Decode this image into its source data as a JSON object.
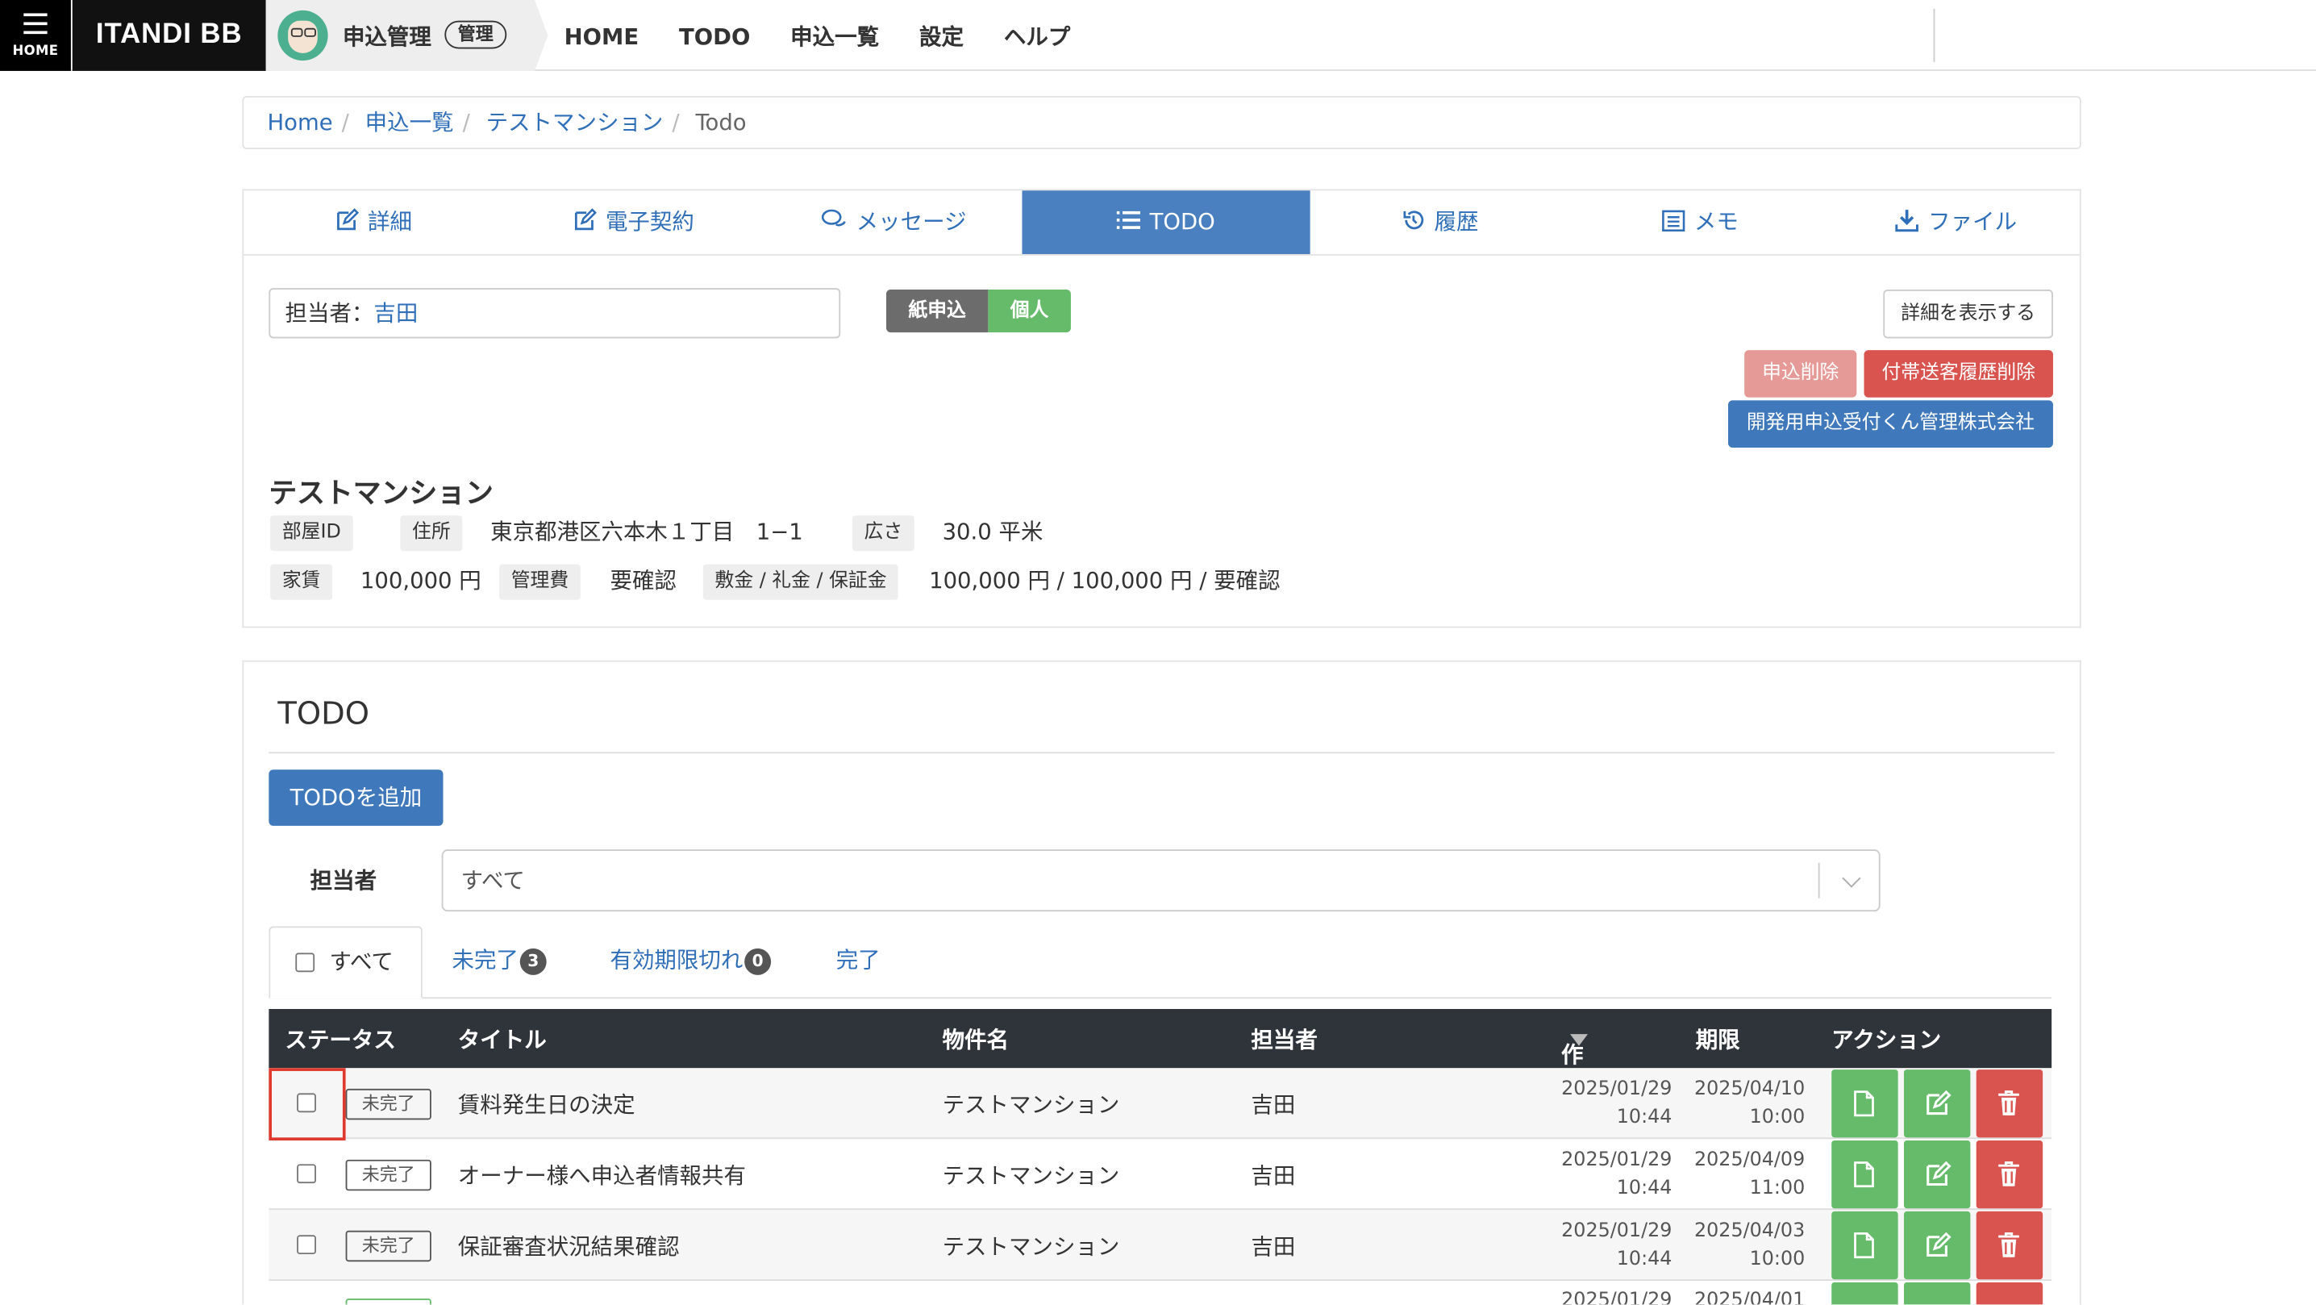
{
  "header": {
    "menu_label": "HOME",
    "brand": "ITANDI BB",
    "app_title": "申込管理",
    "app_badge": "管理",
    "nav": [
      "HOME",
      "TODO",
      "申込一覧",
      "設定",
      "ヘルプ"
    ]
  },
  "breadcrumb": {
    "items": [
      "Home",
      "申込一覧",
      "テストマンション"
    ],
    "current": "Todo"
  },
  "tabs": [
    {
      "label": "詳細",
      "icon": "edit-icon"
    },
    {
      "label": "電子契約",
      "icon": "edit-icon"
    },
    {
      "label": "メッセージ",
      "icon": "chat-icon"
    },
    {
      "label": "TODO",
      "icon": "list-icon",
      "active": true
    },
    {
      "label": "履歴",
      "icon": "history-icon"
    },
    {
      "label": "メモ",
      "icon": "memo-icon"
    },
    {
      "label": "ファイル",
      "icon": "download-icon"
    }
  ],
  "application": {
    "assignee_label": "担当者：",
    "assignee_name": "吉田",
    "type_label": "紙申込",
    "person_label": "個人",
    "show_detail": "詳細を表示する",
    "delete": "申込削除",
    "delete_history": "付帯送客履歴削除",
    "company": "開発用申込受付くん管理株式会社"
  },
  "property": {
    "name": "テストマンション",
    "room_id_label": "部屋ID",
    "address_label": "住所",
    "address": "東京都港区六本木１丁目　1−1",
    "area_label": "広さ",
    "area": "30.0 平米",
    "rent_label": "家賃",
    "rent": "100,000 円",
    "fee_label": "管理費",
    "fee": "要確認",
    "deposit_label": "敷金 / 礼金 / 保証金",
    "deposit": "100,000 円 / 100,000 円 / 要確認"
  },
  "todo": {
    "title": "TODO",
    "add_button": "TODOを追加",
    "filter_label": "担当者",
    "filter_value": "すべて",
    "tab_all": "すべて",
    "tab_incomplete": "未完了",
    "tab_incomplete_count": "3",
    "tab_expired": "有効期限切れ",
    "tab_expired_count": "0",
    "tab_done": "完了",
    "columns": [
      "ステータス",
      "タイトル",
      "物件名",
      "担当者",
      "作成日",
      "期限",
      "アクション"
    ],
    "rows": [
      {
        "status": "未完了",
        "title": "賃料発生日の決定",
        "property": "テストマンション",
        "assignee": "吉田",
        "created_date": "2025/01/29",
        "created_time": "10:44",
        "due_date": "2025/04/10",
        "due_time": "10:00"
      },
      {
        "status": "未完了",
        "title": "オーナー様へ申込者情報共有",
        "property": "テストマンション",
        "assignee": "吉田",
        "created_date": "2025/01/29",
        "created_time": "10:44",
        "due_date": "2025/04/09",
        "due_time": "11:00"
      },
      {
        "status": "未完了",
        "title": "保証審査状況結果確認",
        "property": "テストマンション",
        "assignee": "吉田",
        "created_date": "2025/01/29",
        "created_time": "10:44",
        "due_date": "2025/04/03",
        "due_time": "10:00"
      },
      {
        "status": "",
        "title": "",
        "property": "",
        "assignee": "",
        "created_date": "2025/01/29",
        "created_time": "",
        "due_date": "2025/04/01",
        "due_time": ""
      }
    ]
  },
  "colors": {
    "primary": "#3f79bb",
    "success": "#66bb6a",
    "danger": "#d9534f",
    "danger_light": "#e59a97",
    "dark": "#2f343a"
  }
}
